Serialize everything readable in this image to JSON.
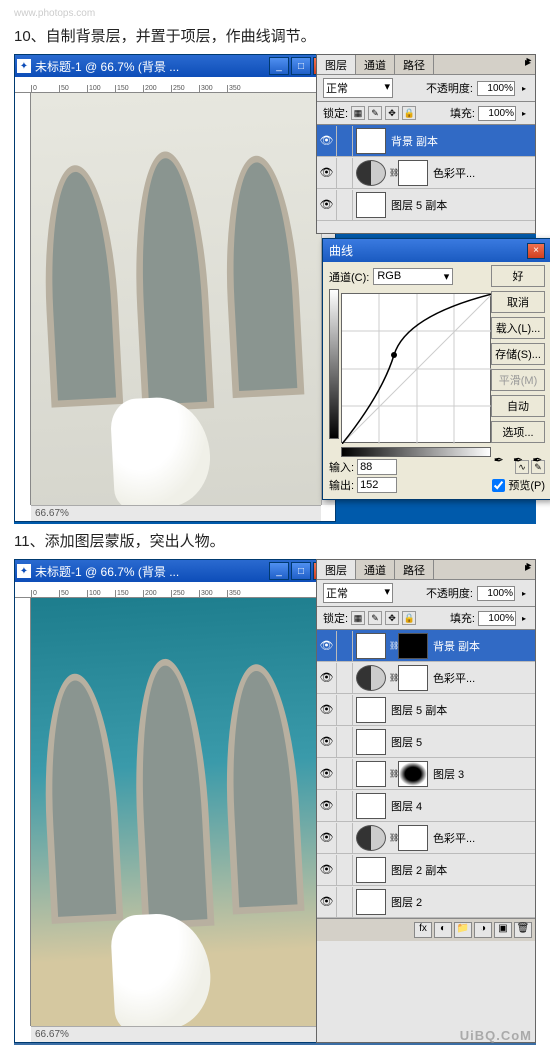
{
  "watermark_top": "www.photops.com",
  "watermark_bottom": "UiBQ.CoM",
  "step10": "10、自制背景层，并置于项层，作曲线调节。",
  "step11": "11、添加图层蒙版，突出人物。",
  "image_window": {
    "title": "未标题-1 @ 66.7% (背景 ...",
    "min": "_",
    "max": "□",
    "close": "×",
    "zoom_status": "66.67%",
    "ruler_ticks": [
      "0",
      "50",
      "100",
      "150",
      "200",
      "250",
      "300",
      "350"
    ]
  },
  "layers_panel": {
    "tabs": {
      "layers": "图层",
      "channels": "通道",
      "paths": "路径"
    },
    "blend_mode": "正常",
    "opacity_label": "不透明度:",
    "opacity_value": "100%",
    "lock_label": "锁定:",
    "fill_label": "填充:",
    "fill_value": "100%",
    "panel1_layers": [
      {
        "name": "背景 副本",
        "selected": true,
        "thumb": "photo",
        "mask": "none"
      },
      {
        "name": "色彩平...",
        "thumb": "adj",
        "mask": "white"
      },
      {
        "name": "图层 5 副本",
        "thumb": "photo",
        "mask": "none"
      }
    ],
    "panel2_layers": [
      {
        "name": "背景 副本",
        "selected": true,
        "thumb": "photo",
        "mask": "black"
      },
      {
        "name": "色彩平...",
        "thumb": "adj",
        "mask": "white"
      },
      {
        "name": "图层 5 副本",
        "thumb": "photo",
        "mask": "none"
      },
      {
        "name": "图层 5",
        "thumb": "photo",
        "mask": "none"
      },
      {
        "name": "图层 3",
        "thumb": "photo",
        "mask": "black-blob"
      },
      {
        "name": "图层 4",
        "thumb": "photo",
        "mask": "none"
      },
      {
        "name": "色彩平...",
        "thumb": "adj",
        "mask": "white"
      },
      {
        "name": "图层 2 副本",
        "thumb": "photo",
        "mask": "none"
      },
      {
        "name": "图层 2",
        "thumb": "photo",
        "mask": "none"
      }
    ]
  },
  "curves": {
    "title": "曲线",
    "channel_label": "通道(C):",
    "channel_value": "RGB",
    "input_label": "输入:",
    "input_value": "88",
    "output_label": "输出:",
    "output_value": "152",
    "btn_ok": "好",
    "btn_cancel": "取消",
    "btn_load": "载入(L)...",
    "btn_save": "存储(S)...",
    "btn_smooth": "平滑(M)",
    "btn_auto": "自动",
    "btn_options": "选项...",
    "preview_label": "预览(P)",
    "close": "×"
  }
}
